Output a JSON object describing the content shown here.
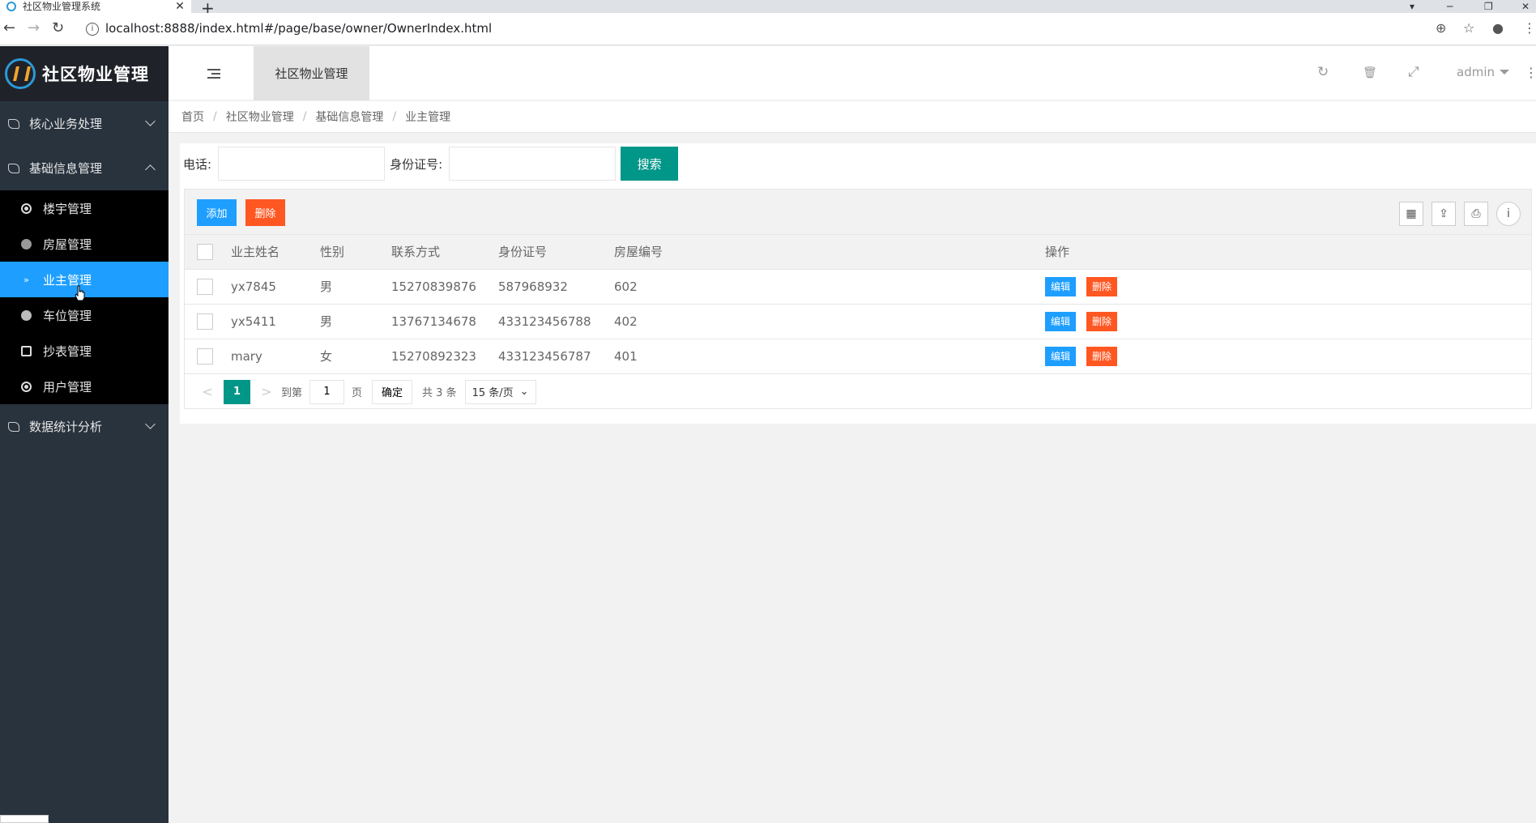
{
  "browser": {
    "tab_title": "社区物业管理系统",
    "tab_close": "✕",
    "new_tab": "+",
    "url": "localhost:8888/index.html#/page/base/owner/OwnerIndex.html",
    "win_min": "─",
    "win_restore": "❐",
    "win_close": "✕"
  },
  "sidebar": {
    "logo_text": "社区物业管理",
    "groups": [
      {
        "label": "核心业务处理"
      },
      {
        "label": "基础信息管理"
      },
      {
        "label": "数据统计分析"
      }
    ],
    "sub_items": [
      {
        "label": "楼宇管理"
      },
      {
        "label": "房屋管理"
      },
      {
        "label": "业主管理"
      },
      {
        "label": "车位管理"
      },
      {
        "label": "抄表管理"
      },
      {
        "label": "用户管理"
      }
    ]
  },
  "header": {
    "tab_label": "社区物业管理",
    "user": "admin"
  },
  "breadcrumb": {
    "items": [
      "首页",
      "社区物业管理",
      "基础信息管理",
      "业主管理"
    ],
    "separator": "/"
  },
  "search": {
    "phone_label": "电话:",
    "idcard_label": "身份证号:",
    "phone_value": "",
    "idcard_value": "",
    "button": "搜索"
  },
  "toolbar": {
    "add_label": "添加",
    "delete_label": "删除"
  },
  "table": {
    "columns": [
      "业主姓名",
      "性别",
      "联系方式",
      "身份证号",
      "房屋编号",
      "操作"
    ],
    "rows": [
      {
        "name": "yx7845",
        "gender": "男",
        "phone": "15270839876",
        "idcard": "587968932",
        "room": "602"
      },
      {
        "name": "yx5411",
        "gender": "男",
        "phone": "13767134678",
        "idcard": "433123456788",
        "room": "402"
      },
      {
        "name": "mary",
        "gender": "女",
        "phone": "15270892323",
        "idcard": "433123456787",
        "room": "401"
      }
    ],
    "edit_label": "编辑",
    "delete_label": "删除"
  },
  "pager": {
    "current": "1",
    "goto_label": "到第",
    "goto_value": "1",
    "page_unit": "页",
    "ok_label": "确定",
    "total": "共 3 条",
    "page_size": "15 条/页",
    "prev": "<",
    "next": ">"
  },
  "icons": {
    "refresh": "↻",
    "clear": "🗑",
    "fullscreen": "⤢",
    "more": "⋮"
  }
}
